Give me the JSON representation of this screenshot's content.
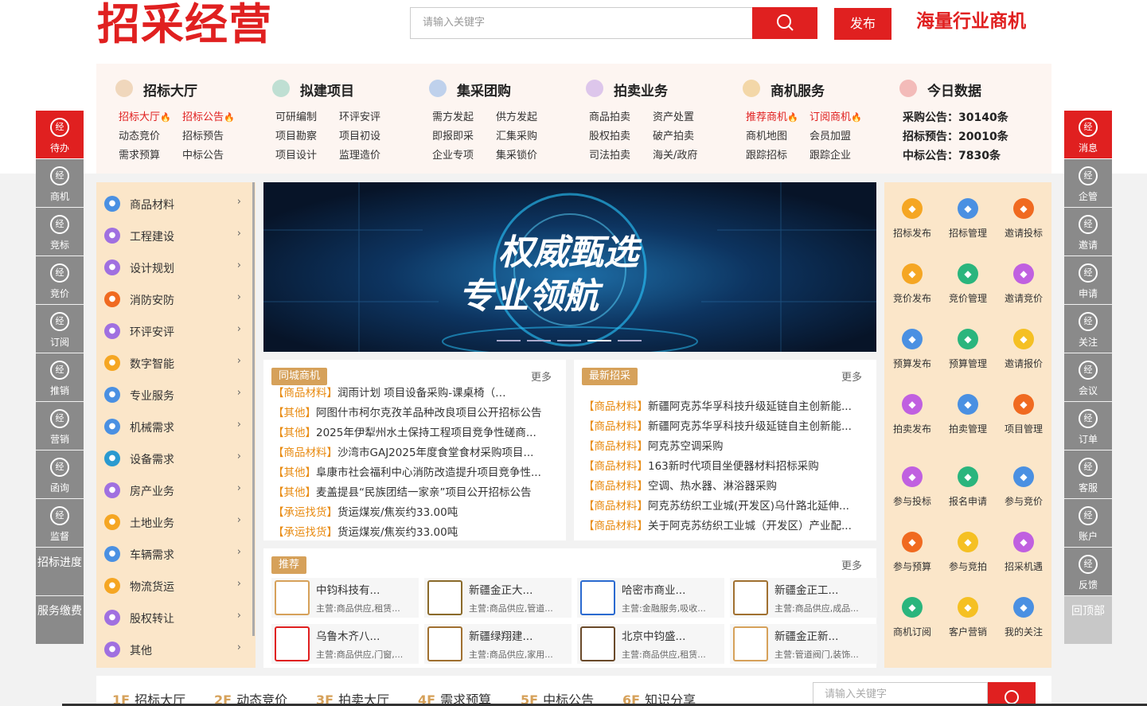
{
  "header": {
    "logo": "招采经营",
    "search_placeholder": "请输入关键字",
    "publish": "发布",
    "slogan": "海量行业商机"
  },
  "menu": [
    {
      "title": "招标大厅",
      "icon": "bank-icon",
      "links": [
        {
          "t": "招标大厅",
          "hot": true
        },
        {
          "t": "招标公告",
          "hot": true
        },
        {
          "t": "动态竞价"
        },
        {
          "t": "招标预告"
        },
        {
          "t": "需求预算"
        },
        {
          "t": "中标公告"
        }
      ]
    },
    {
      "title": "拟建项目",
      "icon": "document-icon",
      "links": [
        {
          "t": "可研编制"
        },
        {
          "t": "环评安评"
        },
        {
          "t": "项目勘察"
        },
        {
          "t": "项目初设"
        },
        {
          "t": "项目设计"
        },
        {
          "t": "监理造价"
        }
      ]
    },
    {
      "title": "集采团购",
      "icon": "cart-icon",
      "links": [
        {
          "t": "需方发起"
        },
        {
          "t": "供方发起"
        },
        {
          "t": "即报即采"
        },
        {
          "t": "汇集采购"
        },
        {
          "t": "企业专项"
        },
        {
          "t": "集采锁价"
        }
      ]
    },
    {
      "title": "拍卖业务",
      "icon": "gavel-icon",
      "links": [
        {
          "t": "商品拍卖"
        },
        {
          "t": "资产处置"
        },
        {
          "t": "股权拍卖"
        },
        {
          "t": "破产拍卖"
        },
        {
          "t": "司法拍卖"
        },
        {
          "t": "海关/政府"
        }
      ]
    },
    {
      "title": "商机服务",
      "icon": "box-icon",
      "links": [
        {
          "t": "推荐商机",
          "hot": true
        },
        {
          "t": "订阅商机",
          "hot": true
        },
        {
          "t": "商机地图"
        },
        {
          "t": "会员加盟"
        },
        {
          "t": "跟踪招标"
        },
        {
          "t": "跟踪企业"
        }
      ]
    },
    {
      "title": "今日数据",
      "icon": "bar-chart-icon",
      "stats": [
        "采购公告：30140条",
        "招标预告：20010条",
        "中标公告：7830条"
      ]
    }
  ],
  "categories": [
    "商品材料",
    "工程建设",
    "设计规划",
    "消防安防",
    "环评安评",
    "数字智能",
    "专业服务",
    "机械需求",
    "设备需求",
    "房产业务",
    "土地业务",
    "车辆需求",
    "物流货运",
    "股权转让",
    "其他"
  ],
  "banner": {
    "line1": "权威甄选",
    "line2": "专业领航"
  },
  "local": {
    "tag": "同城商机",
    "more": "更多",
    "items": [
      {
        "c": "【商品材料】",
        "t": "润雨计划  项目设备采购-课桌椅（…"
      },
      {
        "c": "【其他】",
        "t": "阿图什市柯尔克孜羊品种改良项目公开招标公告"
      },
      {
        "c": "【其他】",
        "t": "2025年伊犁州水土保持工程项目竞争性磋商..."
      },
      {
        "c": "【商品材料】",
        "t": "沙湾市GAJ2025年度食堂食材采购项目..."
      },
      {
        "c": "【其他】",
        "t": "阜康市社会福利中心消防改造提升项目竞争性..."
      },
      {
        "c": "【其他】",
        "t": "麦盖提县“民族团结一家亲”项目公开招标公告"
      },
      {
        "c": "【承运找货】",
        "t": "货运煤炭/焦炭约33.00吨"
      },
      {
        "c": "【承运找货】",
        "t": "货运煤炭/焦炭约33.00吨"
      }
    ]
  },
  "latest": {
    "tag": "最新招采",
    "more": "更多",
    "items": [
      {
        "c": "【商品材料】",
        "t": "新疆阿克苏华孚科技升级延链自主创新能..."
      },
      {
        "c": "【商品材料】",
        "t": "新疆阿克苏华孚科技升级延链自主创新能..."
      },
      {
        "c": "【商品材料】",
        "t": "阿克苏空调采购"
      },
      {
        "c": "【商品材料】",
        "t": "163新时代项目坐便器材料招标采购"
      },
      {
        "c": "【商品材料】",
        "t": "空调、热水器、淋浴器采购"
      },
      {
        "c": "【商品材料】",
        "t": "阿克苏纺织工业城(开发区)乌什路北延伸..."
      },
      {
        "c": "【商品材料】",
        "t": "关于阿克苏纺织工业城（开发区）产业配..."
      }
    ]
  },
  "recommend": {
    "tag": "推荐",
    "more": "更多",
    "items": [
      {
        "n": "中钧科技有...",
        "d": "主营:商品供应,租赁...",
        "logo": "#d6a15a"
      },
      {
        "n": "新疆金正大...",
        "d": "主营:商品供应,管道...",
        "logo": "#8a6a2a"
      },
      {
        "n": "哈密市商业...",
        "d": "主营:金融服务,吸收...",
        "logo": "#2a6ad0"
      },
      {
        "n": "新疆金正工...",
        "d": "主营:商品供应,成品...",
        "logo": "#a07030"
      },
      {
        "n": "乌鲁木齐八...",
        "d": "主营:商品供应,门窗,...",
        "logo": "#e02020"
      },
      {
        "n": "新疆绿翔建...",
        "d": "主营:商品供应,家用...",
        "logo": "#a07030"
      },
      {
        "n": "北京中钧盛...",
        "d": "主营:商品供应,租赁...",
        "logo": "#6a4a2a"
      },
      {
        "n": "新疆金正新...",
        "d": "主营:管道阀门,装饰...",
        "logo": "#d6a15a"
      }
    ]
  },
  "quick": [
    {
      "l": "招标发布",
      "c": "#f5a623"
    },
    {
      "l": "招标管理",
      "c": "#4a90e2"
    },
    {
      "l": "邀请投标",
      "c": "#f06a20"
    },
    {
      "l": "竞价发布",
      "c": "#f5a623"
    },
    {
      "l": "竞价管理",
      "c": "#2ab57d"
    },
    {
      "l": "邀请竞价",
      "c": "#c060e0"
    },
    {
      "l": "预算发布",
      "c": "#4a90e2"
    },
    {
      "l": "预算管理",
      "c": "#2ab57d"
    },
    {
      "l": "邀请报价",
      "c": "#f5c023"
    },
    {
      "l": "拍卖发布",
      "c": "#c060e0"
    },
    {
      "l": "拍卖管理",
      "c": "#4a90e2"
    },
    {
      "l": "项目管理",
      "c": "#f06a20"
    },
    {
      "l": "参与投标",
      "c": "#c060e0"
    },
    {
      "l": "报名申请",
      "c": "#2ab57d"
    },
    {
      "l": "参与竞价",
      "c": "#4a90e2"
    },
    {
      "l": "参与预算",
      "c": "#f06a20"
    },
    {
      "l": "参与竞拍",
      "c": "#f5c023"
    },
    {
      "l": "招采机遇",
      "c": "#c060e0"
    },
    {
      "l": "商机订阅",
      "c": "#2ab57d"
    },
    {
      "l": "客户营销",
      "c": "#f5c023"
    },
    {
      "l": "我的关注",
      "c": "#4a90e2"
    }
  ],
  "left_side": [
    "待办",
    "商机",
    "竞标",
    "竞价",
    "订阅",
    "推销",
    "营销",
    "函询",
    "监督",
    "招标进度",
    "服务缴费"
  ],
  "right_side": [
    "消息",
    "企管",
    "邀请",
    "申请",
    "关注",
    "会议",
    "订单",
    "客服",
    "账户",
    "反馈",
    "回顶部"
  ],
  "floors": [
    {
      "n": "1F",
      "t": "招标大厅"
    },
    {
      "n": "2F",
      "t": "动态竞价"
    },
    {
      "n": "3F",
      "t": "拍卖大厅"
    },
    {
      "n": "4F",
      "t": "需求预算"
    },
    {
      "n": "5F",
      "t": "中标公告"
    },
    {
      "n": "6F",
      "t": "知识分享"
    }
  ],
  "floor_search_placeholder": "请输入关键字"
}
